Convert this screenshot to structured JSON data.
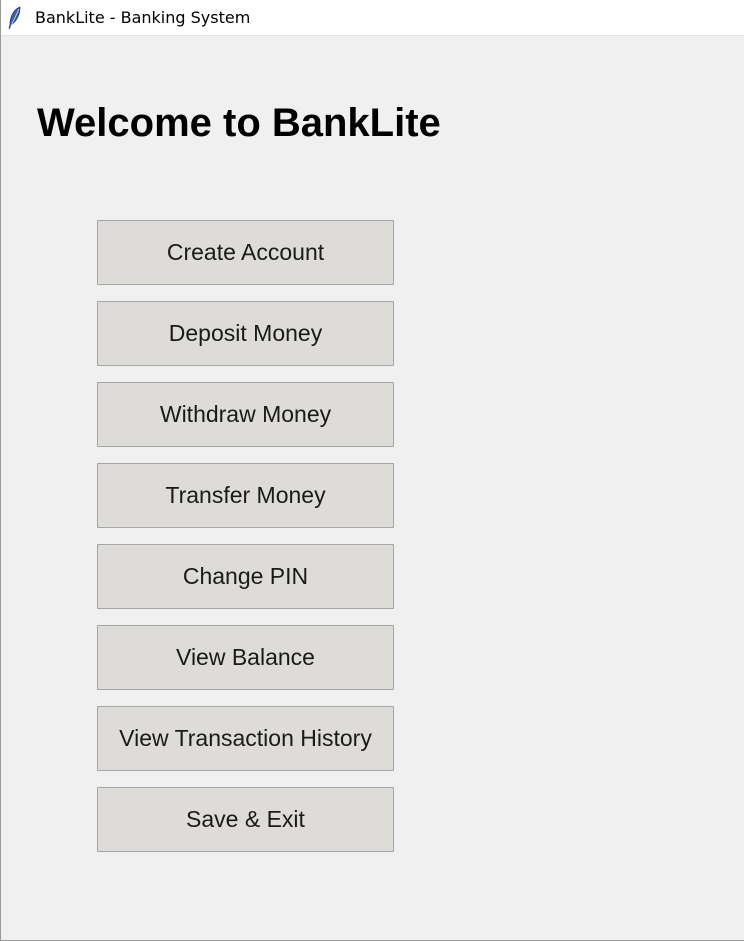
{
  "window": {
    "title": "BankLite - Banking System",
    "icon": "feather-icon"
  },
  "main": {
    "heading": "Welcome to BankLite",
    "buttons": [
      {
        "label": "Create Account"
      },
      {
        "label": "Deposit Money"
      },
      {
        "label": "Withdraw Money"
      },
      {
        "label": "Transfer Money"
      },
      {
        "label": "Change PIN"
      },
      {
        "label": "View Balance"
      },
      {
        "label": "View Transaction History"
      },
      {
        "label": "Save & Exit"
      }
    ]
  },
  "colors": {
    "background": "#f0f0f0",
    "button_face": "#dddcd8",
    "button_border": "#a6a6a6",
    "titlebar": "#ffffff",
    "icon_feather": "#3b5ea8"
  }
}
